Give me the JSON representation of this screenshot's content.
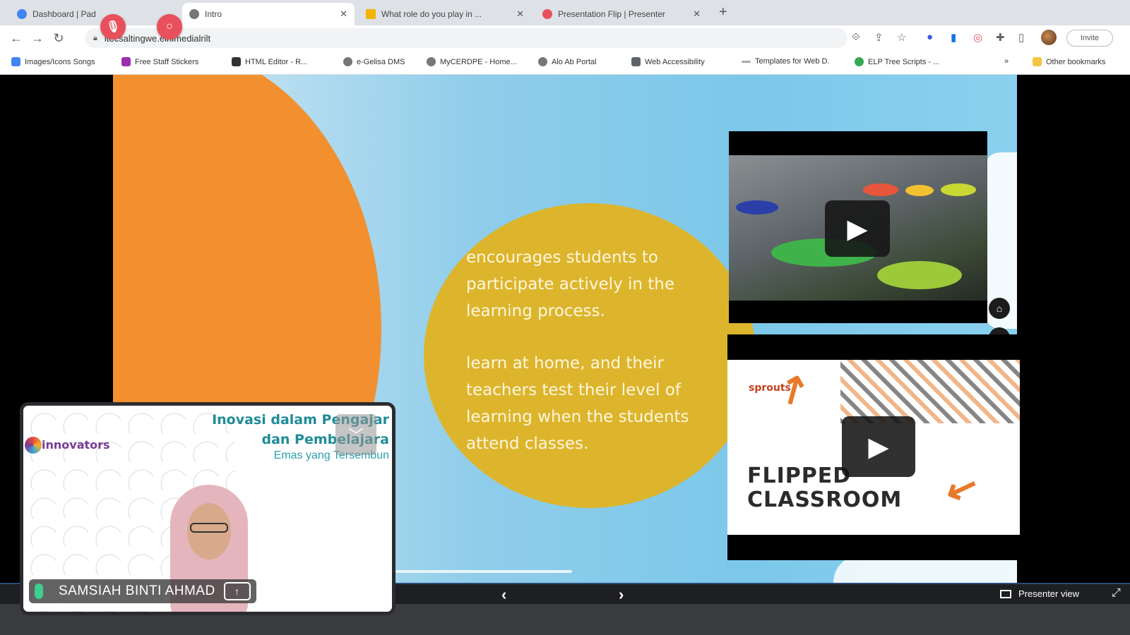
{
  "browser": {
    "tabs": [
      {
        "label": "Dashboard | Pad",
        "active": false
      },
      {
        "label": "Intro",
        "active": true
      },
      {
        "label": "What role do you play in ...",
        "active": false
      },
      {
        "label": "Presentation Flip | Presenter",
        "active": false
      }
    ],
    "new_tab": "+",
    "address": "itecsaltingwe.elnlmedialrilt",
    "profile_label": "Invite",
    "colors": {
      "accent": "#1a73e8",
      "record": "#e8505b"
    }
  },
  "bookmarks": [
    "Images/Icons Songs",
    "Free Staff Stickers",
    "HTML Editor - R...",
    "e-Gelisa DMS",
    "MyCERDPE - Home...",
    "Alo Ab Portal",
    "Web Accessibility",
    "Templates for Web D.",
    "ELP Tree Scripts - ...",
    "Other bookmarks"
  ],
  "slide": {
    "text1": "encourages students to participate actively in the learning process.",
    "text2": "learn at home, and their teachers test their level of learning when the students attend classes.",
    "video2_brand": "sprouts",
    "video2_title_line1": "FLIPPED",
    "video2_title_line2": "CLASSROOM"
  },
  "controls": {
    "prev": "‹",
    "next": "›",
    "presenter_view": "Presenter view"
  },
  "participant": {
    "name": "SAMSIAH BINTI AHMAD",
    "slide_title_line1": "Inovasi dalam Pengajar",
    "slide_title_line2": "dan Pembelajara",
    "slide_subtitle": "Emas yang Tersembun",
    "logo_text": "innovators"
  }
}
